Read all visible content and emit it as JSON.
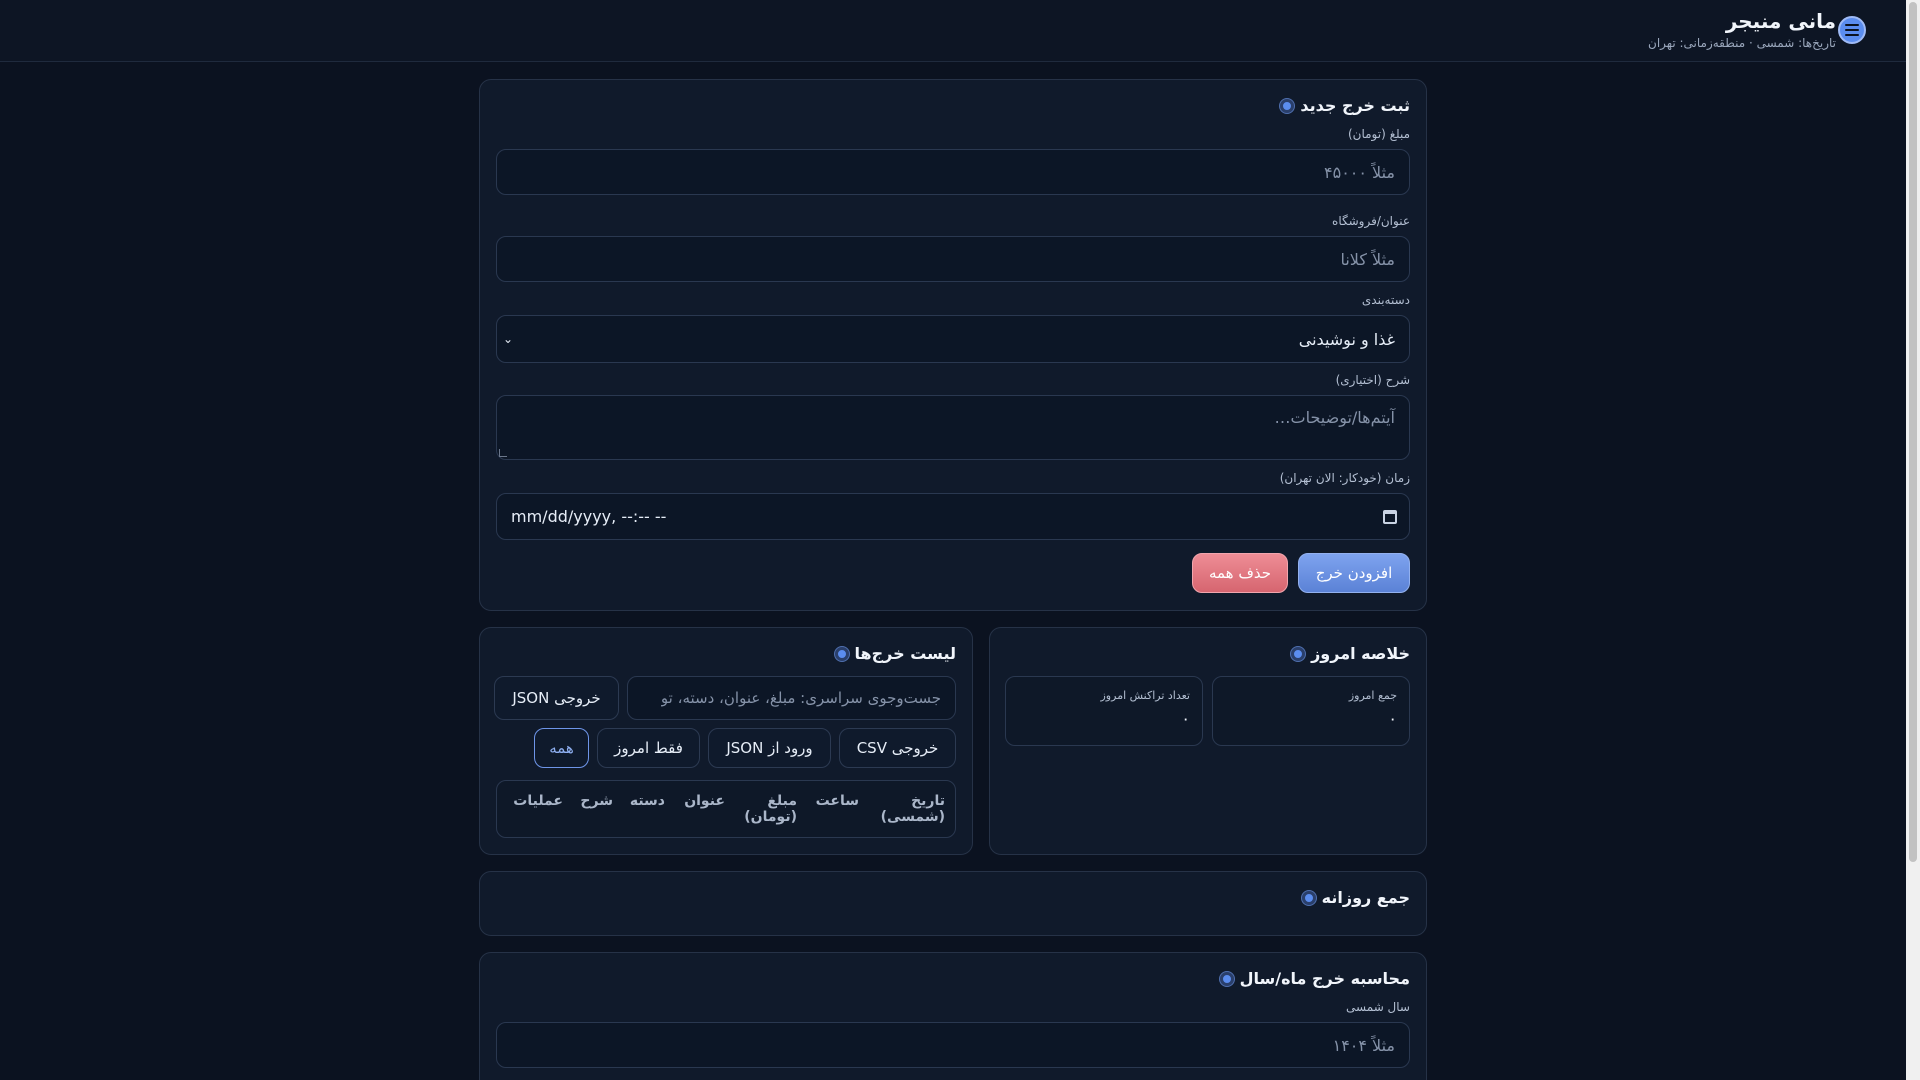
{
  "header": {
    "title": "مانی منیجر",
    "subtitle": "تاریخ‌ها: شمسی · منطقه‌زمانی: تهران"
  },
  "new_expense": {
    "title": "ثبت خرج جدید",
    "amount_label": "مبلغ (تومان)",
    "amount_placeholder": "مثلاً ۴۵۰۰۰",
    "title_label": "عنوان/فروشگاه",
    "title_placeholder": "مثلاً کلانا",
    "category_label": "دسته‌بندی",
    "category_value": "غذا و نوشیدنی",
    "desc_label": "شرح (اختیاری)",
    "desc_placeholder": "آیتم‌ها/توضیحات…",
    "time_label": "زمان (خودکار: الان تهران)",
    "time_value": "mm/dd/yyyy, --:-- --",
    "add_button": "افزودن خرج",
    "delete_all_button": "حذف همه"
  },
  "summary": {
    "title": "خلاصه امروز",
    "total_label": "جمع امروز",
    "total_value": "۰",
    "count_label": "تعداد تراکنش امروز",
    "count_value": "۰"
  },
  "list": {
    "title": "لیست خرج‌ها",
    "search_placeholder": "جست‌وجوی سراسری: مبلغ، عنوان، دسته، تو",
    "export_json": "خروجی JSON",
    "export_csv": "خروجی CSV",
    "import_json": "ورود از JSON",
    "today_only": "فقط امروز",
    "all": "همه",
    "columns": {
      "date_l1": "تاریخ",
      "date_l2": "(شمسی)",
      "time": "ساعت",
      "amount_l1": "مبلغ",
      "amount_l2": "(تومان)",
      "title": "عنوان",
      "category": "دسته",
      "desc": "شرح",
      "actions": "عملیات"
    }
  },
  "daily": {
    "title": "جمع روزانه"
  },
  "period": {
    "title": "محاسبه خرج ماه/سال",
    "year_label": "سال شمسی",
    "year_placeholder": "مثلاً ۱۴۰۴"
  },
  "colors": {
    "background": "#0b1220",
    "card": "#101a2b",
    "accent": "#5b8def",
    "danger": "#d66570"
  }
}
